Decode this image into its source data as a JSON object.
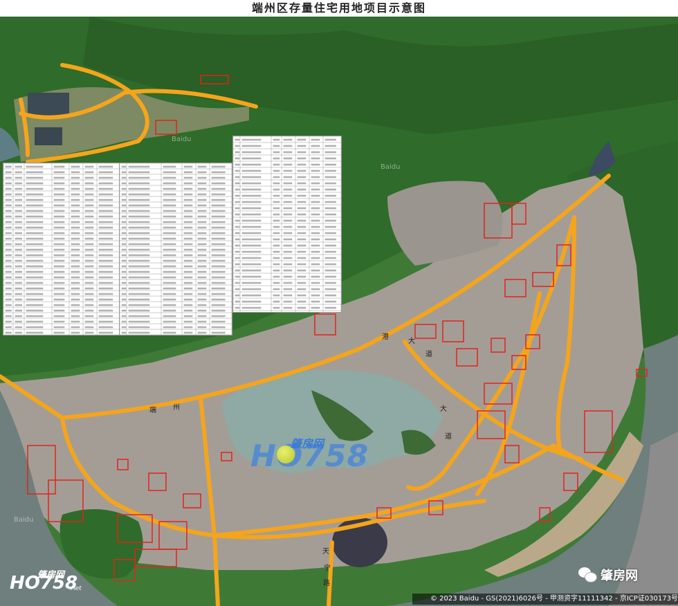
{
  "title": "端州区存量住宅用地项目示意图",
  "watermark": {
    "brand_cn": "肇房网",
    "brand_num": "HO758",
    "brand_suffix": ".net"
  },
  "corner_logo": {
    "brand_cn": "肇房网",
    "brand_num": "HO758",
    "brand_suffix": ".net"
  },
  "wechat": {
    "icon": "wechat-icon",
    "account_name": "肇房网"
  },
  "copyright": "© 2023 Baidu - GS(2021)6026号 - 甲测资字11111342 - 京ICP证030173号",
  "baidu_marks": [
    "Baidu",
    "Baidu",
    "Baidu"
  ],
  "road_labels": [
    "港",
    "大",
    "道",
    "端",
    "州",
    "大",
    "道",
    "天",
    "宁",
    "路"
  ],
  "colors": {
    "road": "#f5a51c",
    "plot_outline": "#e0241b",
    "water": "#8fa9a4",
    "river": "#6e7f7d",
    "forest": "#2f6b2a",
    "urban": "#a49d96"
  }
}
